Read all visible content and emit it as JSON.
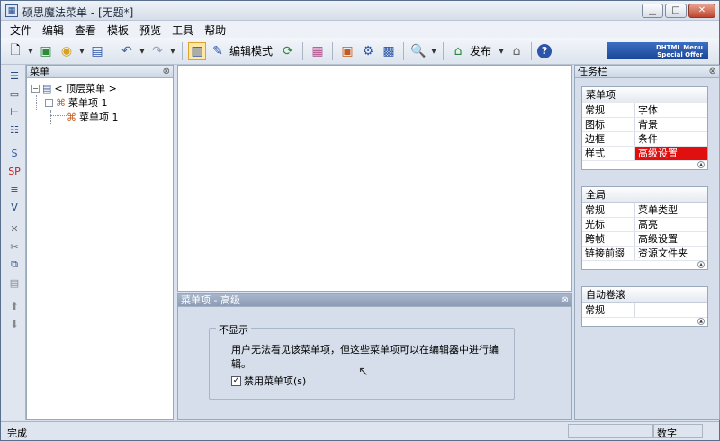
{
  "window": {
    "title": "硕思魔法菜单 - [无题*]",
    "minimize": "▁",
    "maximize": "□",
    "close": "✕",
    "icon": "app-icon"
  },
  "menubar": [
    "文件",
    "编辑",
    "查看",
    "模板",
    "预览",
    "工具",
    "帮助"
  ],
  "toolbar": {
    "edit_mode_label": "编辑模式",
    "publish_label": "发布",
    "promo_line1": "DHTML Menu",
    "promo_line2": "Special Offer"
  },
  "tree_panel": {
    "title": "菜单",
    "root": "< 顶层菜单 >",
    "item1": "菜单项 1",
    "item1_child": "菜单项 1",
    "expand_symbol": "−"
  },
  "advanced_panel": {
    "title": "菜单项 - 高级",
    "group_title": "不显示",
    "description": "用户无法看见该菜单项，但这些菜单项可以在编辑器中进行编辑。",
    "checkbox_label": "禁用菜单项(s)",
    "checkbox_checked": true,
    "check_mark": "✓"
  },
  "taskpane": {
    "title": "任务栏",
    "groups": [
      {
        "title": "菜单项",
        "rows": [
          [
            "常规",
            "字体"
          ],
          [
            "图标",
            "背景"
          ],
          [
            "边框",
            "条件"
          ],
          [
            "样式",
            "高级设置"
          ]
        ]
      },
      {
        "title": "全局",
        "rows": [
          [
            "常规",
            "菜单类型"
          ],
          [
            "光标",
            "高亮"
          ],
          [
            "跨帧",
            "高级设置"
          ],
          [
            "链接前缀",
            "资源文件夹"
          ]
        ]
      },
      {
        "title": "自动卷滚",
        "rows": [
          [
            "常规",
            ""
          ]
        ]
      }
    ],
    "selected": "高级设置"
  },
  "statusbar": {
    "status": "完成",
    "mode": "数字"
  }
}
